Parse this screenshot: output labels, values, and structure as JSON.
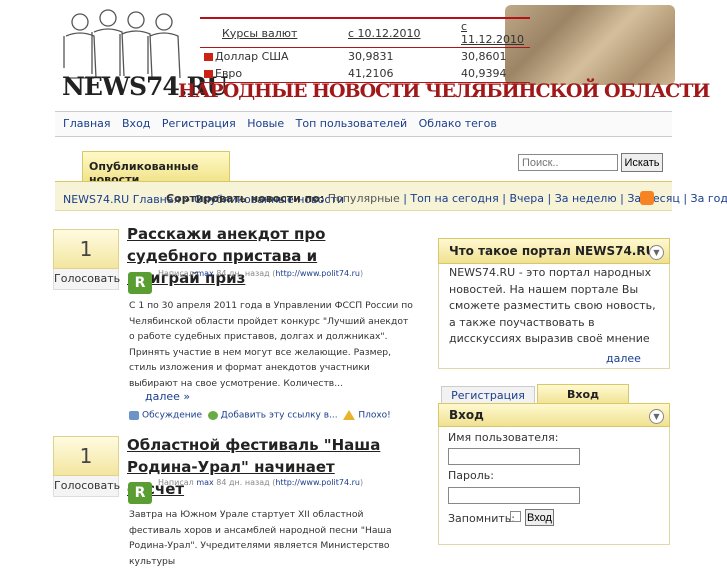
{
  "site": {
    "logo_text": "NEWS74.RU",
    "banner_title": "НАРОДНЫЕ НОВОСТИ ЧЕЛЯБИНСКОЙ ОБЛАСТИ"
  },
  "currency": {
    "header": [
      "Курсы валют",
      "с 10.12.2010",
      "с 11.12.2010"
    ],
    "rows": [
      {
        "name": "Доллар США",
        "v1": "30,9831",
        "v2": "30,8601"
      },
      {
        "name": "Евро",
        "v1": "41,2106",
        "v2": "40,9394"
      }
    ]
  },
  "nav": [
    "Главная",
    "Вход",
    "Регистрация",
    "Новые",
    "Топ пользователей",
    "Облако тегов"
  ],
  "tab": {
    "label": "Опубликованные новости"
  },
  "search": {
    "placeholder": "Поиск..",
    "button": "Искать"
  },
  "breadcrumb": {
    "home": "NEWS74.RU Главная",
    "sep": " » ",
    "current": "Опубликованные новости"
  },
  "sort": {
    "label": "Сортировать новости по:",
    "options": [
      "Популярные",
      "Топ на сегодня",
      "Вчера",
      "За неделю",
      "За месяц",
      "За год"
    ]
  },
  "news": [
    {
      "votes": "1",
      "vote_label": "Голосовать",
      "title": "Расскажи анекдот про судебного пристава и выиграй приз",
      "meta_prefix": "Написал",
      "author": "max",
      "age": "84 дн. назад",
      "source": "http://www.polit74.ru",
      "body": "С 1 по 30 апреля 2011 года в Управлении ФССП России по Челябинской области пройдет конкурс \"Лучший анекдот о работе судебных приставов, долгах и должниках\". Принять участие в нем могут все желающие. Размер, стиль изложения и формат анекдотов участники выбирают на свое усмотрение. Количеств...",
      "more": "далее",
      "actions": [
        "Обсуждение",
        "Добавить эту ссылку в...",
        "Плохо!"
      ]
    },
    {
      "votes": "1",
      "vote_label": "Голосовать",
      "title": "Областной фестиваль \"Наша Родина-Урал\" начинает отсчет",
      "meta_prefix": "Написал",
      "author": "max",
      "age": "84 дн. назад",
      "source": "http://www.polit74.ru",
      "body": "Завтра на Южном Урале стартует XII областной фестиваль хоров и ансамблей народной песни \"Наша Родина-Урал\". Учредителями является Министерство культуры"
    }
  ],
  "about": {
    "title": "Что такое портал NEWS74.RU",
    "text": "NEWS74.RU - это портал народных новостей. На нашем портале Вы сможете разместить свою новость, а также поучаствовать в дисскуссиях выразив своё мнение",
    "more": "далее"
  },
  "login": {
    "tab_register": "Регистрация",
    "tab_login": "Вход",
    "title": "Вход",
    "username_label": "Имя пользователя:",
    "password_label": "Пароль:",
    "remember_label": "Запомнить:",
    "button": "Вход"
  },
  "colors": {
    "accent": "#b31317",
    "link": "#1a3e8c",
    "tab_yellow": "#f1e48b"
  }
}
